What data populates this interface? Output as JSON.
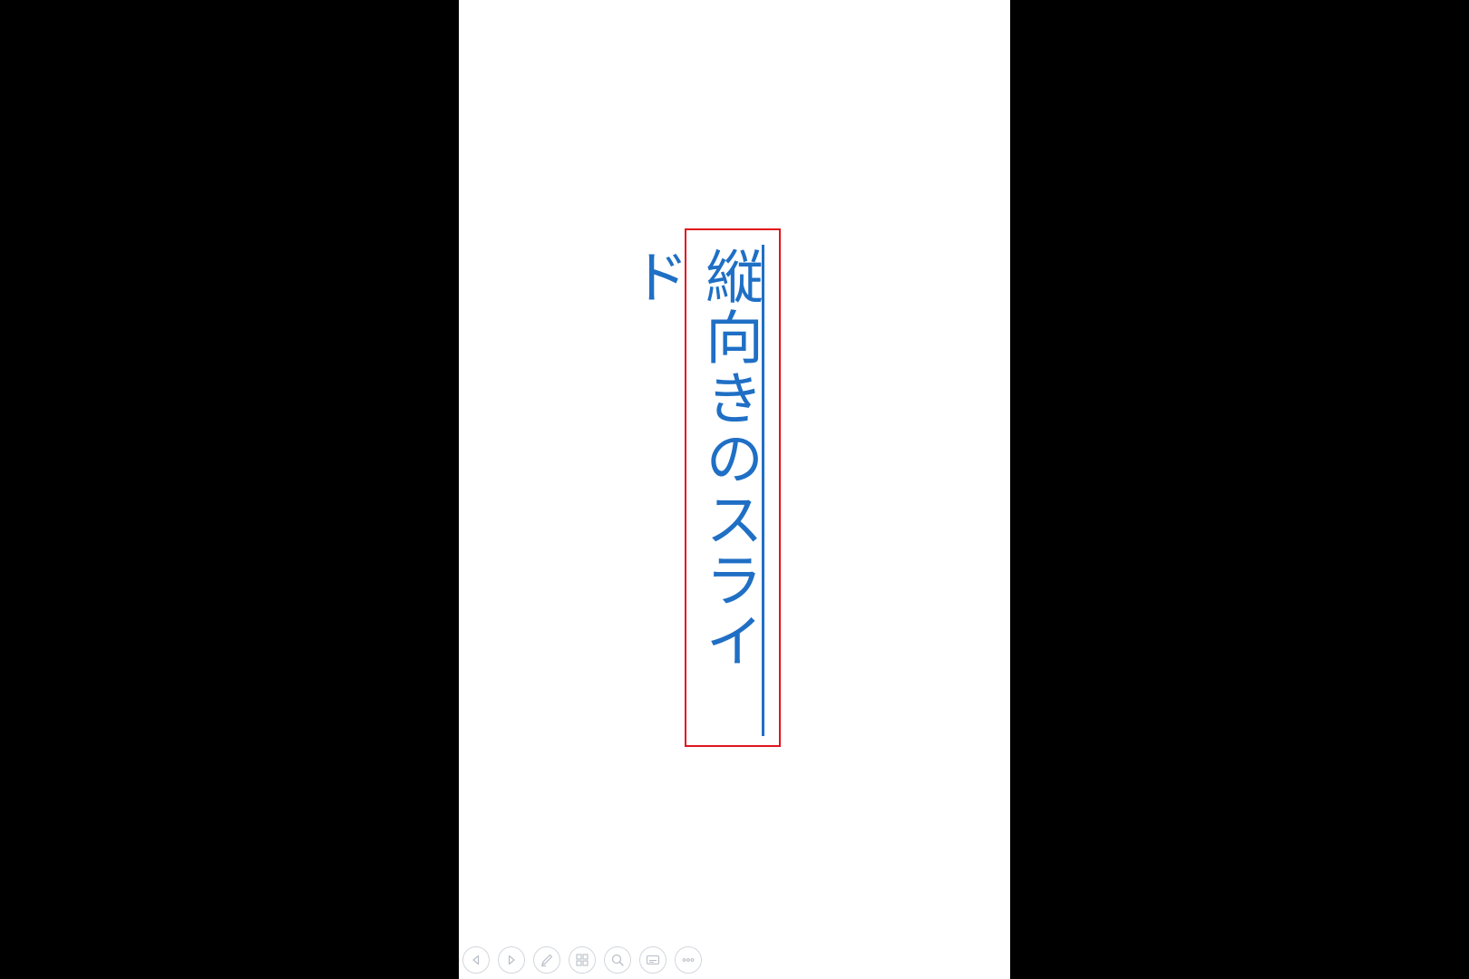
{
  "slide": {
    "title_text": "縦向きのスライド",
    "text_color": "#1f6fc5",
    "highlight_color": "#e0141e",
    "background": "#ffffff"
  },
  "toolbar": {
    "buttons": [
      {
        "name": "previous-slide",
        "icon": "triangle-left-icon"
      },
      {
        "name": "next-slide",
        "icon": "triangle-right-icon"
      },
      {
        "name": "pen-tool",
        "icon": "pen-icon"
      },
      {
        "name": "see-all-slides",
        "icon": "slides-grid-icon"
      },
      {
        "name": "zoom",
        "icon": "magnifier-icon"
      },
      {
        "name": "subtitles",
        "icon": "subtitles-icon"
      },
      {
        "name": "more-options",
        "icon": "ellipsis-icon"
      }
    ]
  }
}
